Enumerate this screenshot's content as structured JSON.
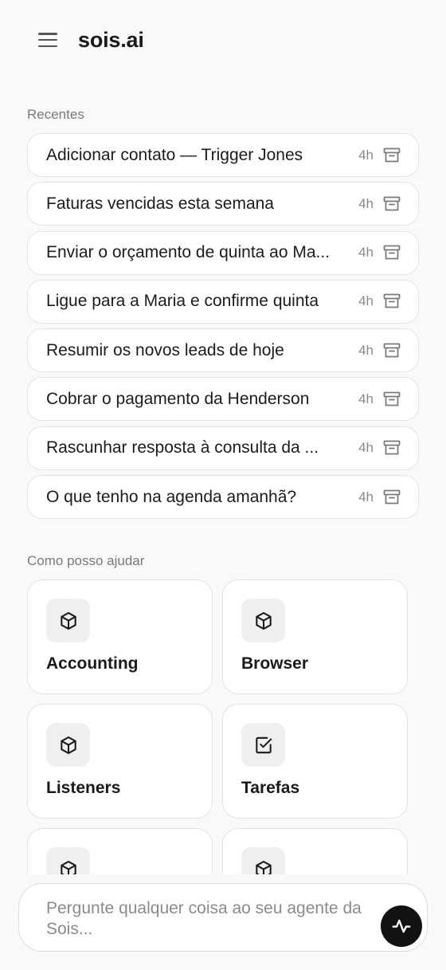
{
  "header": {
    "brand": "sois.ai"
  },
  "recent": {
    "label": "Recentes",
    "items": [
      {
        "title": "Adicionar contato — Trigger Jones",
        "time": "4h"
      },
      {
        "title": "Faturas vencidas esta semana",
        "time": "4h"
      },
      {
        "title": "Enviar o orçamento de quinta ao Ma...",
        "time": "4h"
      },
      {
        "title": "Ligue para a Maria e confirme quinta",
        "time": "4h"
      },
      {
        "title": "Resumir os novos leads de hoje",
        "time": "4h"
      },
      {
        "title": "Cobrar o pagamento da Henderson",
        "time": "4h"
      },
      {
        "title": "Rascunhar resposta à consulta da ...",
        "time": "4h"
      },
      {
        "title": "O que tenho na agenda amanhã?",
        "time": "4h"
      }
    ]
  },
  "help": {
    "label": "Como posso ajudar",
    "cards": [
      {
        "label": "Accounting",
        "icon": "cube-icon"
      },
      {
        "label": "Browser",
        "icon": "cube-icon"
      },
      {
        "label": "Listeners",
        "icon": "cube-icon"
      },
      {
        "label": "Tarefas",
        "icon": "checkbox-icon"
      },
      {
        "label": "",
        "icon": "cube-icon"
      },
      {
        "label": "",
        "icon": "cube-icon"
      }
    ]
  },
  "input": {
    "placeholder": "Pergunte qualquer coisa ao seu agente da Sois..."
  },
  "colors": {
    "accent": "#121212",
    "background": "#f8f9fa",
    "border": "#e2e3e5"
  }
}
